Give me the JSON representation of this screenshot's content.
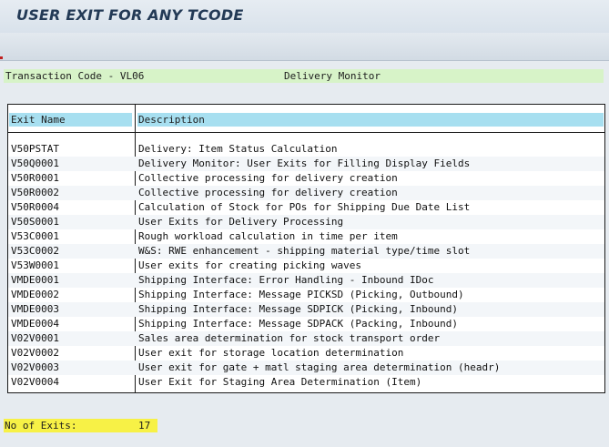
{
  "window": {
    "title": "USER EXIT FOR ANY TCODE"
  },
  "transaction": {
    "label": "Transaction Code - VL06",
    "description": "Delivery Monitor"
  },
  "table": {
    "headers": [
      "Exit Name",
      "Description"
    ],
    "rows": [
      [
        "V50PSTAT",
        "Delivery: Item Status Calculation"
      ],
      [
        "V50Q0001",
        "Delivery Monitor: User Exits for Filling Display Fields"
      ],
      [
        "V50R0001",
        "Collective processing for delivery creation"
      ],
      [
        "V50R0002",
        "Collective processing for delivery creation"
      ],
      [
        "V50R0004",
        "Calculation of Stock for POs for Shipping Due Date List"
      ],
      [
        "V50S0001",
        "User Exits for Delivery Processing"
      ],
      [
        "V53C0001",
        "Rough workload calculation in time per item"
      ],
      [
        "V53C0002",
        "W&S: RWE enhancement - shipping material type/time slot"
      ],
      [
        "V53W0001",
        "User exits for creating picking waves"
      ],
      [
        "VMDE0001",
        "Shipping Interface: Error Handling - Inbound IDoc"
      ],
      [
        "VMDE0002",
        "Shipping Interface: Message PICKSD (Picking, Outbound)"
      ],
      [
        "VMDE0003",
        "Shipping Interface: Message SDPICK (Picking, Inbound)"
      ],
      [
        "VMDE0004",
        "Shipping Interface: Message SDPACK (Packing, Inbound)"
      ],
      [
        "V02V0001",
        "Sales area determination for stock transport order"
      ],
      [
        "V02V0002",
        "User exit for storage location determination"
      ],
      [
        "V02V0003",
        "User exit for gate + matl staging area determination (headr)"
      ],
      [
        "V02V0004",
        "User Exit for Staging Area Determination (Item)"
      ]
    ]
  },
  "summary": {
    "label": "No of Exits:",
    "value": "17"
  },
  "colors": {
    "transaction_highlight": "#d7f3c8",
    "header_highlight": "#a7dff0",
    "count_highlight": "#f7f146",
    "title_text": "#233a56"
  }
}
